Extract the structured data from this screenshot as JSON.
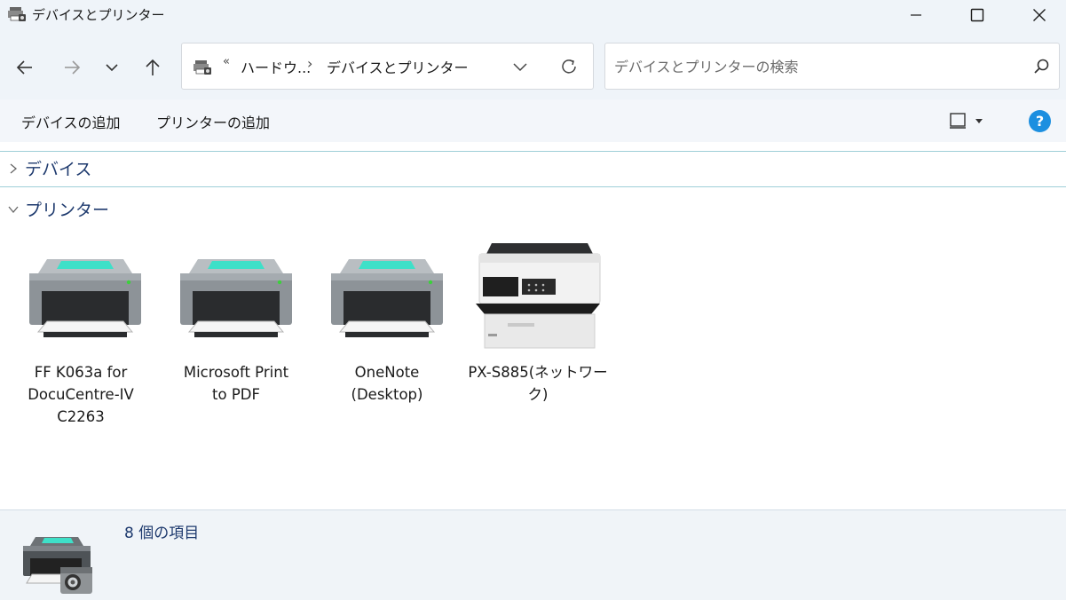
{
  "window": {
    "title": "デバイスとプリンター",
    "icon": "devices-printers-icon"
  },
  "navigation": {
    "back_icon": "arrow-left-icon",
    "forward_icon": "arrow-right-icon",
    "recent_icon": "chevron-down-icon",
    "up_icon": "arrow-up-icon"
  },
  "address": {
    "overflow": "«",
    "crumbs": [
      "ハードウ...",
      "デバイスとプリンター"
    ],
    "separator": "›"
  },
  "search": {
    "placeholder": "デバイスとプリンターの検索"
  },
  "commands": {
    "add_device": "デバイスの追加",
    "add_printer": "プリンターの追加"
  },
  "groups": {
    "devices": {
      "title": "デバイス",
      "expanded": false
    },
    "printers": {
      "title": "プリンター",
      "expanded": true
    }
  },
  "printers": [
    {
      "name_lines": [
        "FF K063a for",
        "DocuCentre-IV",
        "C2263"
      ],
      "icon": "generic-printer-icon"
    },
    {
      "name_lines": [
        "Microsoft Print",
        "to PDF",
        ""
      ],
      "icon": "generic-printer-icon"
    },
    {
      "name_lines": [
        "OneNote",
        "(Desktop)",
        ""
      ],
      "icon": "generic-printer-icon"
    },
    {
      "name_lines": [
        "PX-S885(ネットワー",
        "ク)",
        ""
      ],
      "icon": "epson-printer-icon"
    }
  ],
  "details": {
    "count_text": "8 個の項目"
  },
  "colors": {
    "chrome_bg": "#eff4f9",
    "accent_teal": "#3ee0c8",
    "group_title": "#1e3a6e",
    "help_blue": "#1c8fe0"
  }
}
